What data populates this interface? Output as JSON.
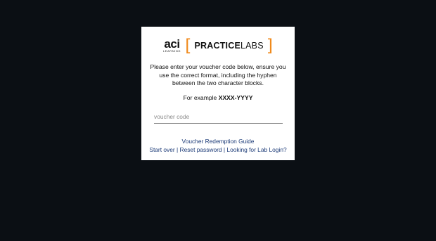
{
  "logo": {
    "aci": "aci",
    "aci_sub": "LEARNING",
    "bracket_open": "[",
    "brand_bold": "PRACTICE",
    "brand_light": "LABS",
    "bracket_close": "]"
  },
  "instructions": "Please enter your voucher code below, ensure you use the correct format, including the hyphen between the two character blocks.",
  "example": {
    "prefix": "For example",
    "code": "XXXX-YYYY"
  },
  "voucher_input": {
    "value": "",
    "placeholder": "voucher code"
  },
  "links": {
    "guide": "Voucher Redemption Guide",
    "start_over": "Start over",
    "reset_password": "Reset password",
    "lab_login": "Looking for Lab Login?",
    "separator": "|"
  },
  "colors": {
    "background": "#0b0f14",
    "card": "#ffffff",
    "accent_orange": "#f08a1c",
    "link": "#1b3a77"
  }
}
